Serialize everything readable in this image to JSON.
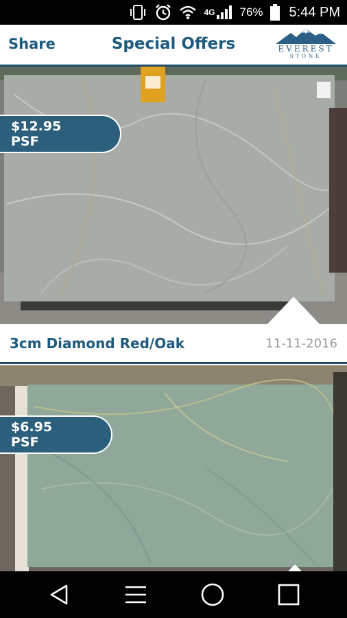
{
  "status_bar": {
    "network": "4G",
    "battery_percent": "76%",
    "time": "5:44 PM",
    "icons": [
      "vibrate-icon",
      "alarm-icon",
      "wifi-icon",
      "signal-icon",
      "battery-icon"
    ]
  },
  "header": {
    "share_label": "Share",
    "title": "Special Offers",
    "logo_text": "EVEREST",
    "logo_sub": "STONE"
  },
  "offers": [
    {
      "price": "$12.95 PSF",
      "name": "3cm Diamond Red/Oak",
      "date": "11-11-2016"
    },
    {
      "price": "$6.95 PSF"
    }
  ],
  "nav_bar": {
    "icons": [
      "back-icon",
      "menu-icon",
      "home-icon",
      "recents-icon"
    ]
  },
  "colors": {
    "brand": "#1e5a7e",
    "badge": "#2c5f7c",
    "date": "#9a9a9a"
  }
}
